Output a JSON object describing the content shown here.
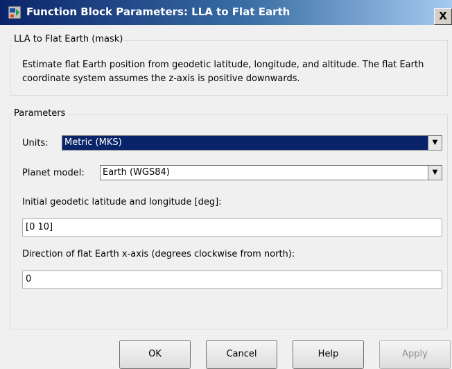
{
  "window": {
    "title": "Function Block Parameters: LLA to Flat Earth",
    "close_label": "X"
  },
  "mask_group": {
    "label": "LLA to Flat Earth (mask)",
    "description": "Estimate flat Earth position from geodetic latitude, longitude, and altitude.  The flat Earth coordinate system assumes the z-axis is positive downwards."
  },
  "parameters_group": {
    "label": "Parameters",
    "units": {
      "label": "Units:",
      "value": "Metric (MKS)"
    },
    "planet_model": {
      "label": "Planet model:",
      "value": "Earth (WGS84)"
    },
    "initial_lat_lon": {
      "label": "Initial geodetic latitude and longitude [deg]:",
      "value": "[0 10]"
    },
    "x_axis_direction": {
      "label": "Direction of flat Earth x-axis (degrees clockwise from north):",
      "value": "0"
    }
  },
  "buttons": {
    "ok": "OK",
    "cancel": "Cancel",
    "help": "Help",
    "apply": "Apply"
  },
  "colors": {
    "title_gradient_start": "#0a246a",
    "selected_background": "#0a246a",
    "dialog_background": "#f0f0f0"
  },
  "icons": {
    "title_icon": "simulink-block-icon",
    "dropdown_icon": "dropdown-arrow-icon"
  }
}
